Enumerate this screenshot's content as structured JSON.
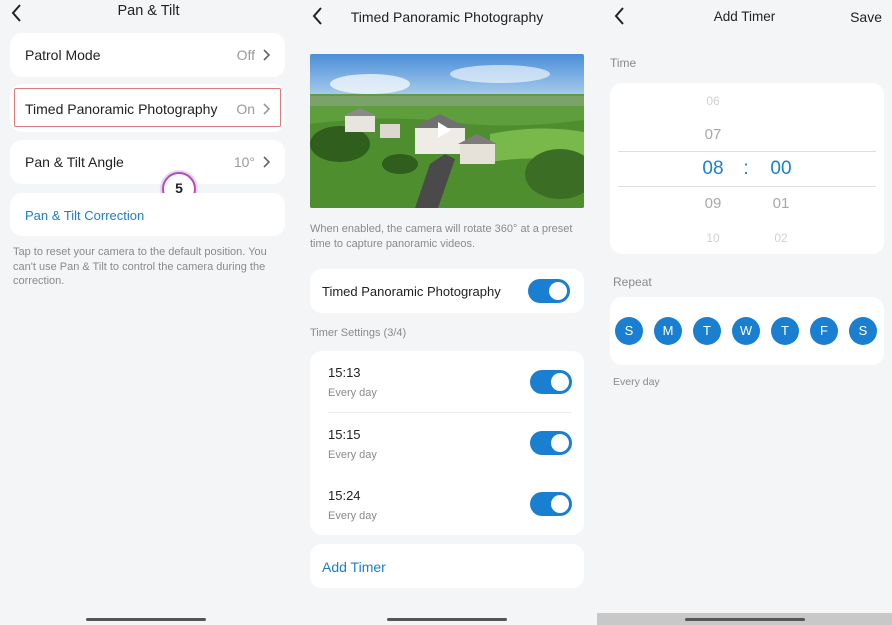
{
  "panel1": {
    "title": "Pan & Tilt",
    "rows": [
      {
        "label": "Patrol Mode",
        "value": "Off"
      },
      {
        "label": "Timed Panoramic Photography",
        "value": "On"
      },
      {
        "label": "Pan & Tilt Angle",
        "value": "10°"
      }
    ],
    "correction_label": "Pan & Tilt Correction",
    "correction_note": "Tap to reset your camera to the default position. You can't use Pan & Tilt to control the camera during the correction.",
    "step_badge": "5"
  },
  "panel2": {
    "title": "Timed Panoramic Photography",
    "video_description": "When enabled, the camera will rotate 360° at a preset time to capture panoramic videos.",
    "main_toggle_label": "Timed Panoramic Photography",
    "timer_settings_label": "Timer Settings (3/4)",
    "timers": [
      {
        "time": "15:13",
        "repeat": "Every day"
      },
      {
        "time": "15:15",
        "repeat": "Every day"
      },
      {
        "time": "15:24",
        "repeat": "Every day"
      }
    ],
    "add_timer_label": "Add Timer"
  },
  "panel3": {
    "title": "Add Timer",
    "save_label": "Save",
    "time_label": "Time",
    "hours": [
      "06",
      "07",
      "08",
      "09",
      "10"
    ],
    "minutes": [
      "00",
      "01",
      "02"
    ],
    "separator": ":",
    "repeat_label": "Repeat",
    "days": [
      "S",
      "M",
      "T",
      "W",
      "T",
      "F",
      "S"
    ],
    "repeat_summary": "Every day"
  },
  "colors": {
    "accent": "#1a7fd0",
    "highlight_border": "#e07a7a"
  }
}
